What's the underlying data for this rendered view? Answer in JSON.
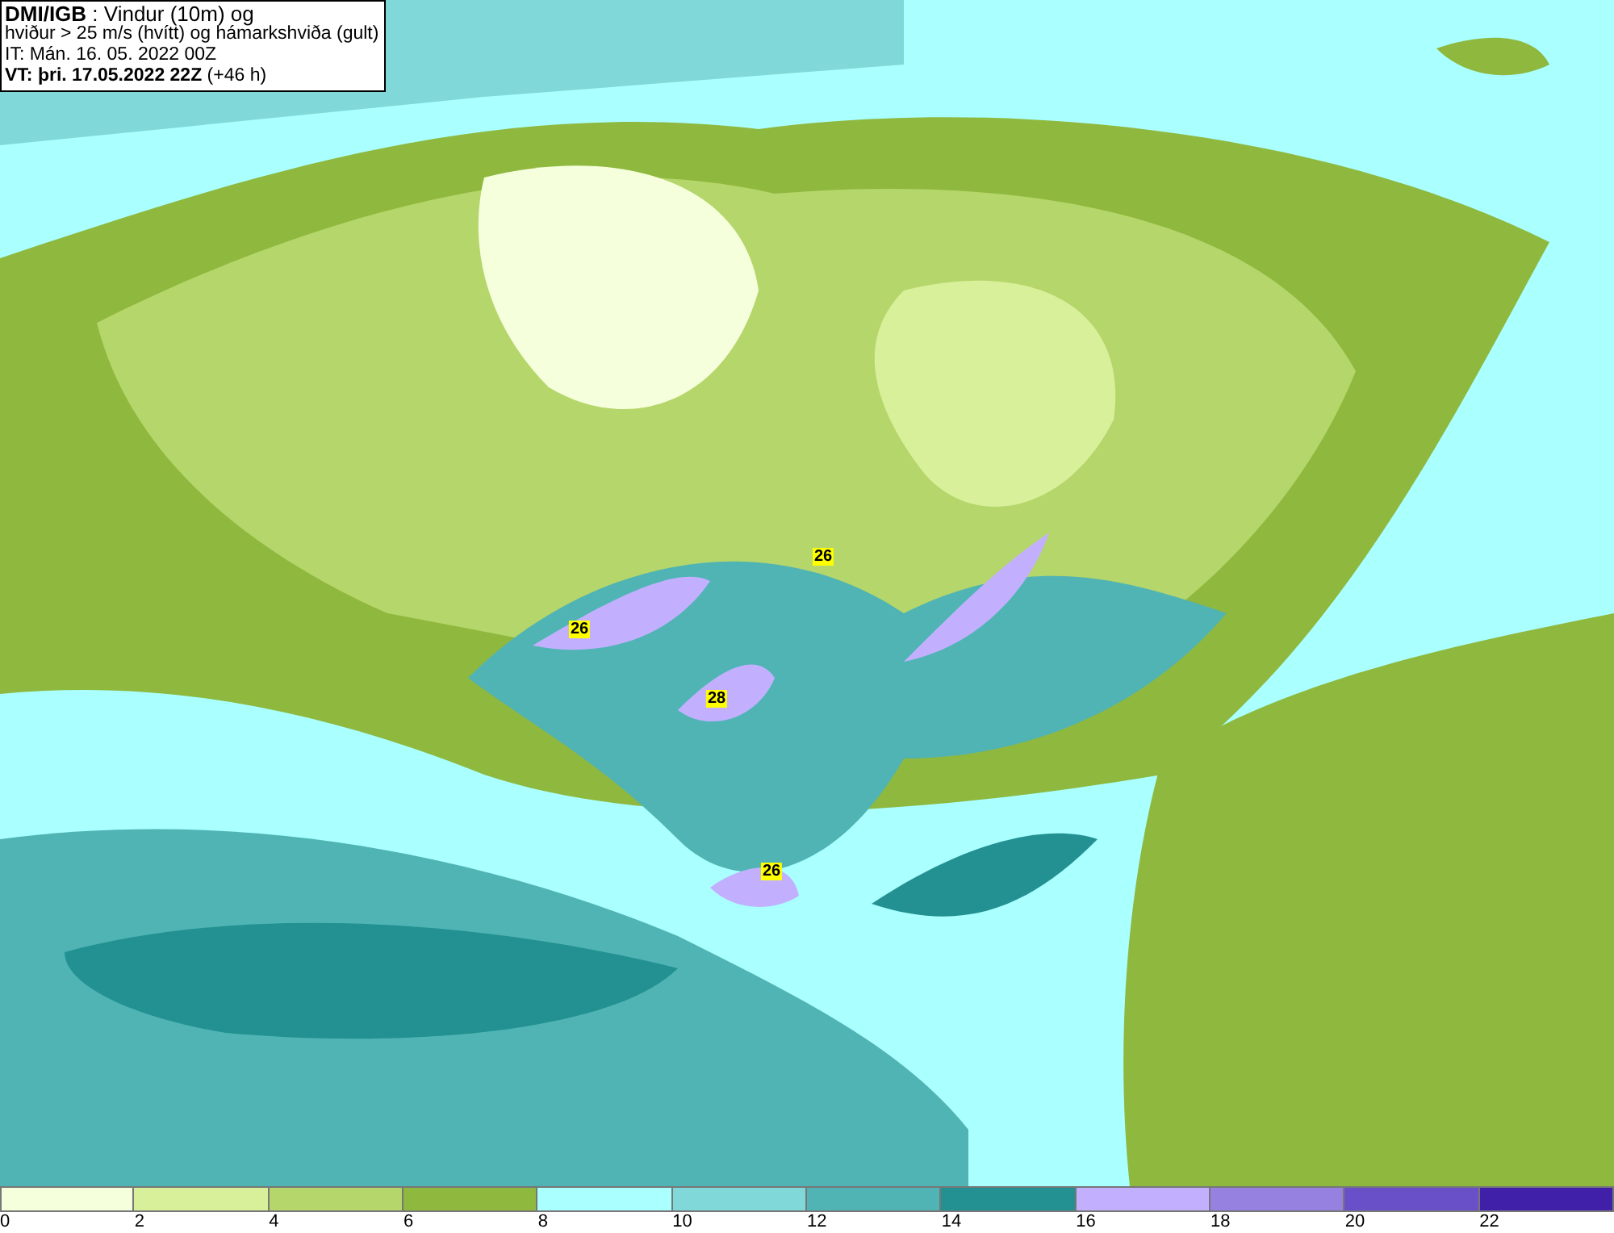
{
  "title_box": {
    "lines": [
      "**DMI/IGB** : Vindur (10m) og",
      "hviður > 25 m/s (hvítt) og hámarkshviða (gult)",
      "IT: Mán. 16. 05. 2022 00Z",
      "**VT: þri. 17.05.2022 22Z** (+46 h)"
    ]
  },
  "gust_labels": [
    {
      "text": "26"
    },
    {
      "text": "26"
    },
    {
      "text": "28"
    },
    {
      "text": "26"
    }
  ],
  "legend": {
    "bins": [
      {
        "color": "#f5ffdc"
      },
      {
        "color": "#d8f09a"
      },
      {
        "color": "#b5d66a"
      },
      {
        "color": "#8fb83e"
      },
      {
        "color": "#aaffff"
      },
      {
        "color": "#80d8d8"
      },
      {
        "color": "#50b4b4"
      },
      {
        "color": "#239191"
      },
      {
        "color": "#c2b0ff"
      },
      {
        "color": "#9680e0"
      },
      {
        "color": "#6a50c8"
      },
      {
        "color": "#4020a8"
      }
    ],
    "ticks": [
      "0",
      "2",
      "4",
      "6",
      "8",
      "10",
      "12",
      "14",
      "16",
      "18",
      "20",
      "22"
    ]
  }
}
